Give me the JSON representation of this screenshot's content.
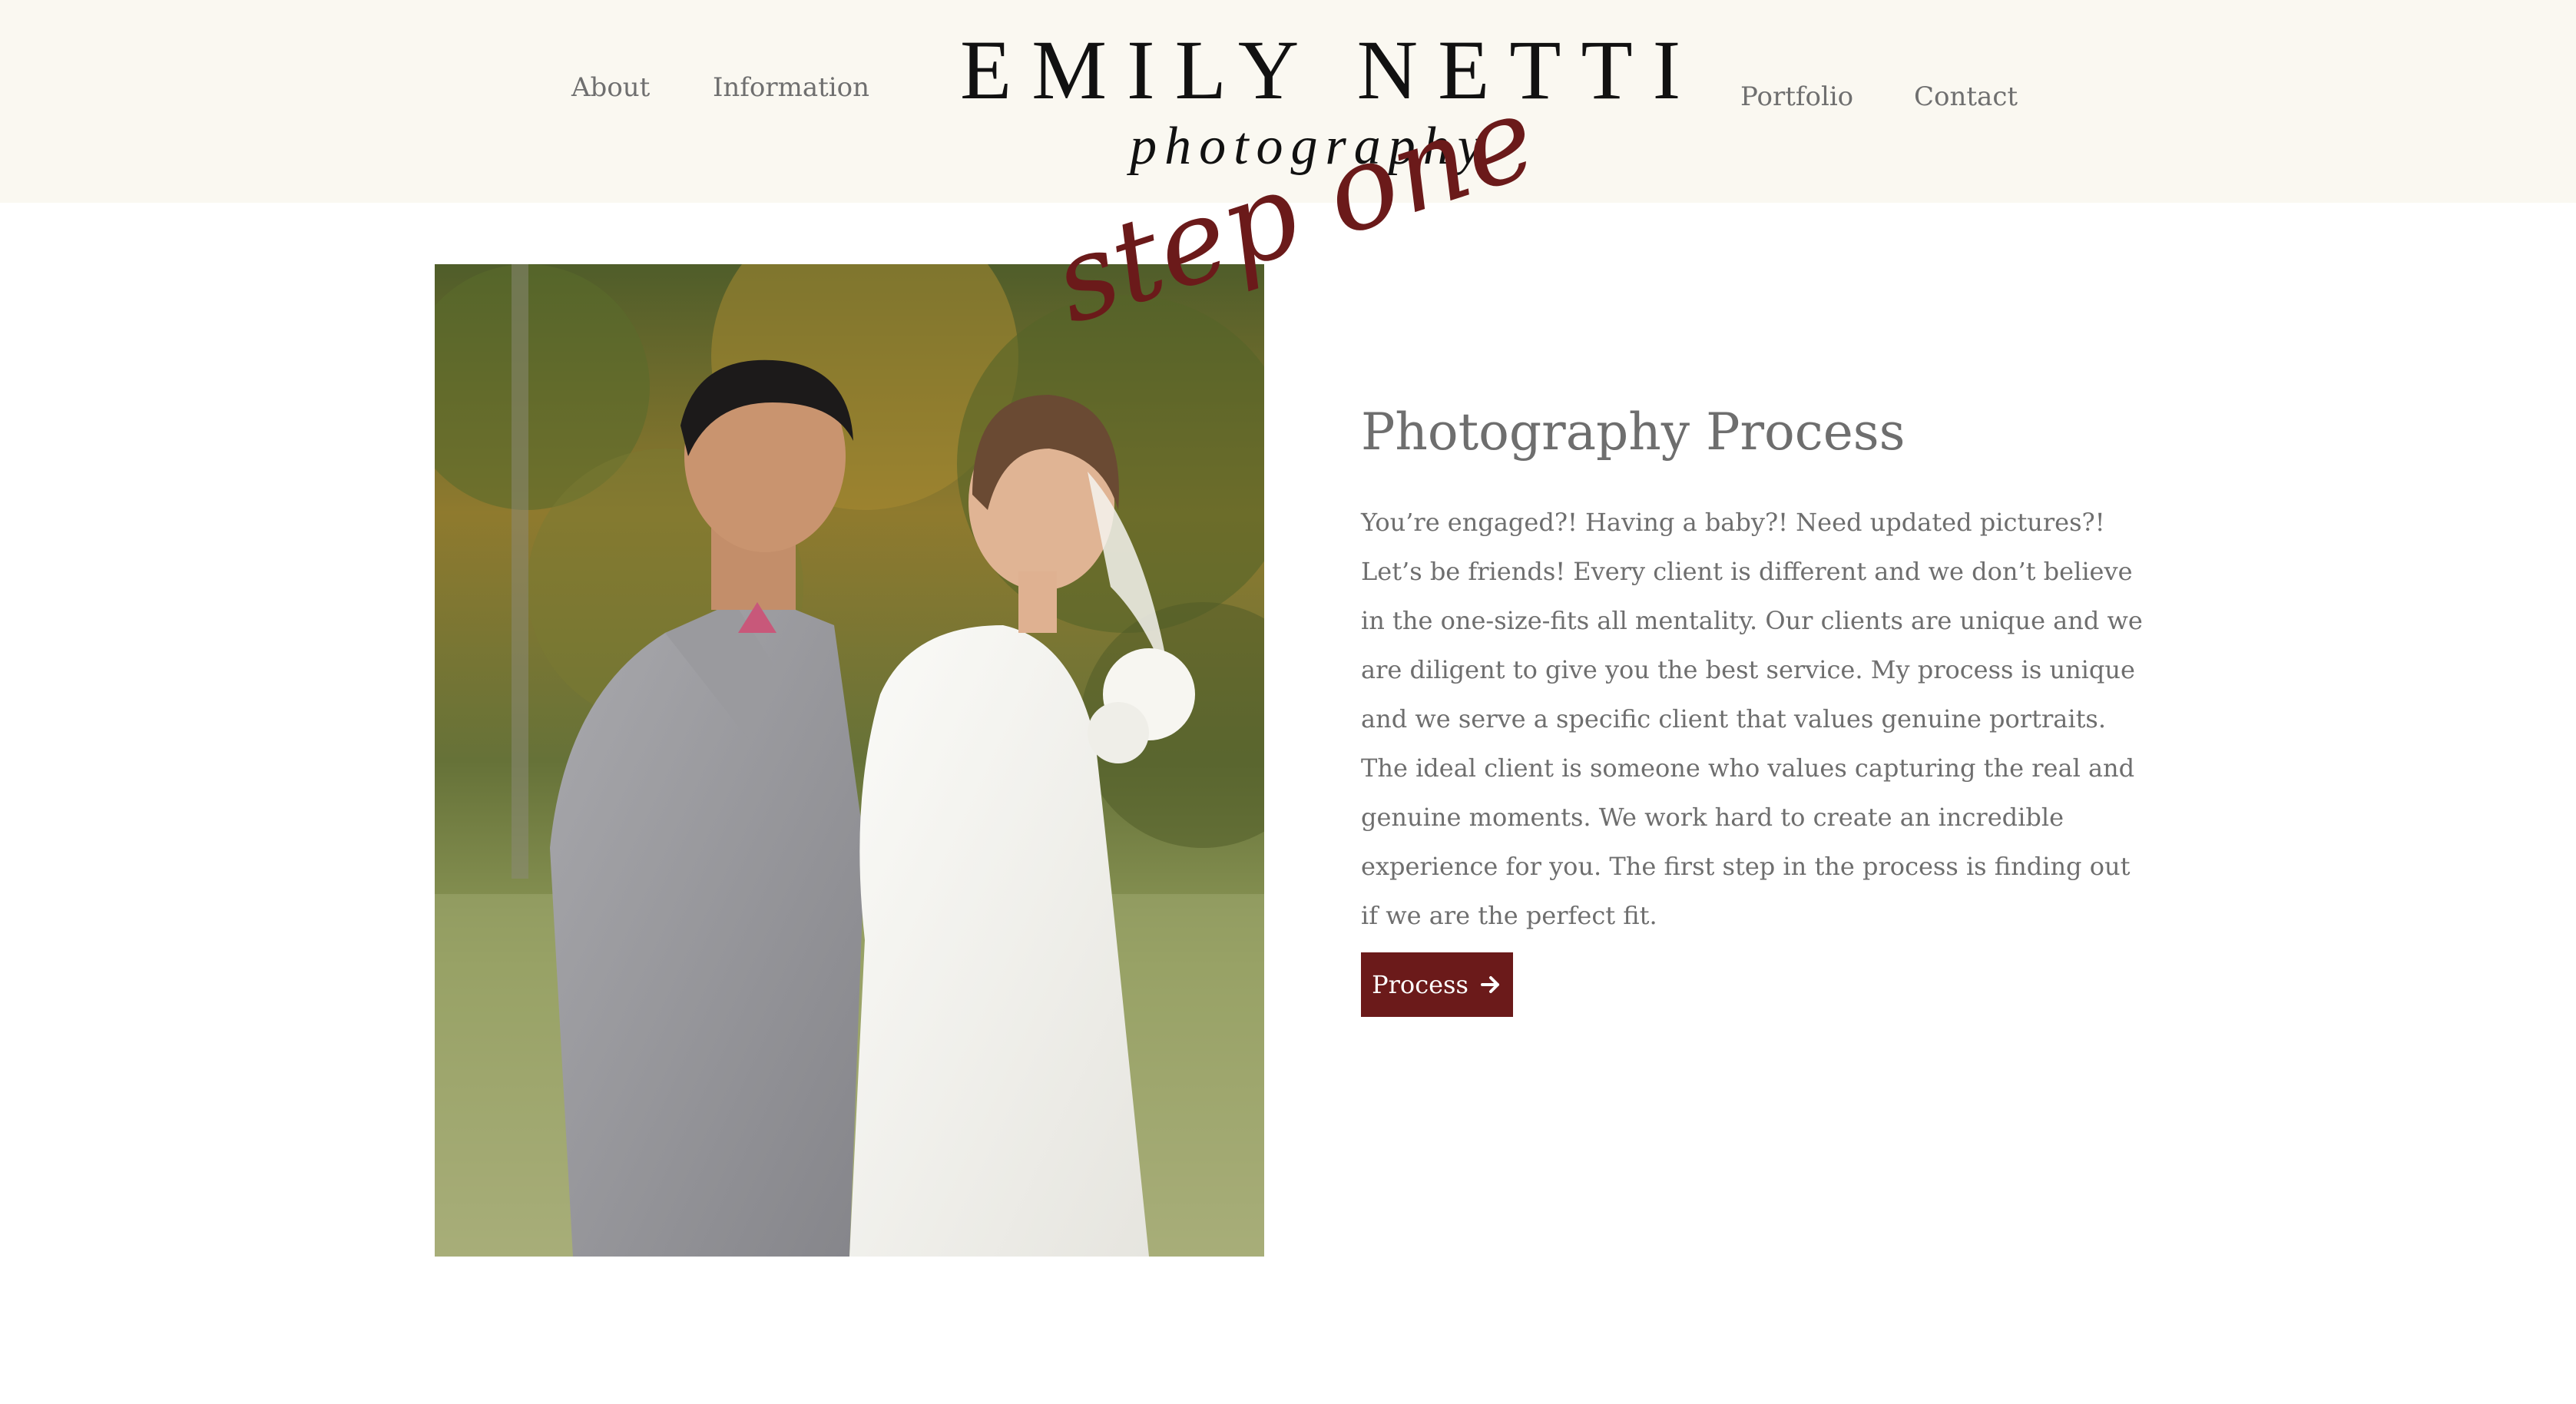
{
  "header": {
    "nav_left": [
      "About",
      "Information"
    ],
    "nav_right": [
      "Portfolio",
      "Contact"
    ],
    "logo": {
      "name": "EMILY NETTI",
      "tagline": "photography"
    }
  },
  "main": {
    "step_label": "step one",
    "title": "Photography Process",
    "body": "You’re engaged?! Having a baby?! Need updated pictures?! Let’s be friends! Every client is different and we don’t believe in the one-size-fits all mentality. Our clients are unique and we are diligent to give you the best service. My process is unique and we serve a specific client that values genuine portraits. The ideal client is someone who values capturing the real and genuine moments. We work hard to create an incredible experience for you. The first step in the process is finding out if we are the perfect fit.",
    "button_label": "Process",
    "button_icon": "arrow-right-icon"
  },
  "colors": {
    "header_bg": "#faf8f1",
    "accent": "#6b1a1a",
    "text": "#6e6e6e",
    "logo": "#111111"
  }
}
